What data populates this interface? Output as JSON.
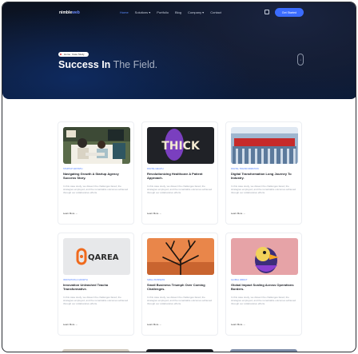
{
  "header": {
    "logo_main": "nimble",
    "logo_accent": "web",
    "nav": [
      {
        "label": "Home",
        "active": true
      },
      {
        "label": "Solutions ▾",
        "active": false
      },
      {
        "label": "Portfolio",
        "active": false
      },
      {
        "label": "Blog",
        "active": false
      },
      {
        "label": "Company ▾",
        "active": false
      },
      {
        "label": "Contact",
        "active": false
      }
    ],
    "icon": "grid-icon",
    "cta": "Get Started"
  },
  "hero": {
    "breadcrumb": [
      "Home",
      "Case Study"
    ],
    "title_bold": "Success In",
    "title_rest": " The Field.",
    "handle_glyph": "↓"
  },
  "cards": [
    {
      "category": "Startup Growth",
      "title": "Navigating Growth A Startup Agency Success Story.",
      "desc": "In this case study, we dissect the challenges faced, the strategies employed, and the remarkable outcomes achieved through our collaborative efforts.",
      "more": "Learn More →"
    },
    {
      "category": "Digital Health",
      "title": "Revolutionizing Healthcare A Patient Approach.",
      "desc": "In this case study, we dissect the challenges faced, the strategies employed, and the remarkable outcomes achieved through our collaborative efforts.",
      "more": "Learn More →"
    },
    {
      "category": "Digital Transformation",
      "title": "Digital Transformation Long Journey To Industry.",
      "desc": "In this case study, we dissect the challenges faced, the strategies employed, and the remarkable outcomes achieved through our collaborative efforts.",
      "more": "Learn More →"
    },
    {
      "category": "Innovation & Growth",
      "title": "Innovation Unleashed Teacha Transformative.",
      "desc": "In this case study, we dissect the challenges faced, the strategies employed, and the remarkable outcomes achieved through our collaborative efforts.",
      "more": "Learn More →"
    },
    {
      "category": "Small Business",
      "title": "Small Business Triumph Over Coming Challenges.",
      "desc": "In this case study, we dissect the challenges faced, the strategies employed, and the remarkable outcomes achieved through our collaborative efforts.",
      "more": "Learn More →"
    },
    {
      "category": "Global Impact",
      "title": "Global Impact Scaling Across Operations Borders.",
      "desc": "In this case study, we dissect the challenges faced, the strategies employed, and the remarkable outcomes achieved through our collaborative efforts.",
      "more": "Learn More →"
    }
  ],
  "thumb_texts": {
    "thick": "THICK",
    "qarea": "QAREA"
  },
  "colors": {
    "accent": "#3b6cff",
    "hero_bg": "#0b1220",
    "link": "#4c7dff"
  }
}
